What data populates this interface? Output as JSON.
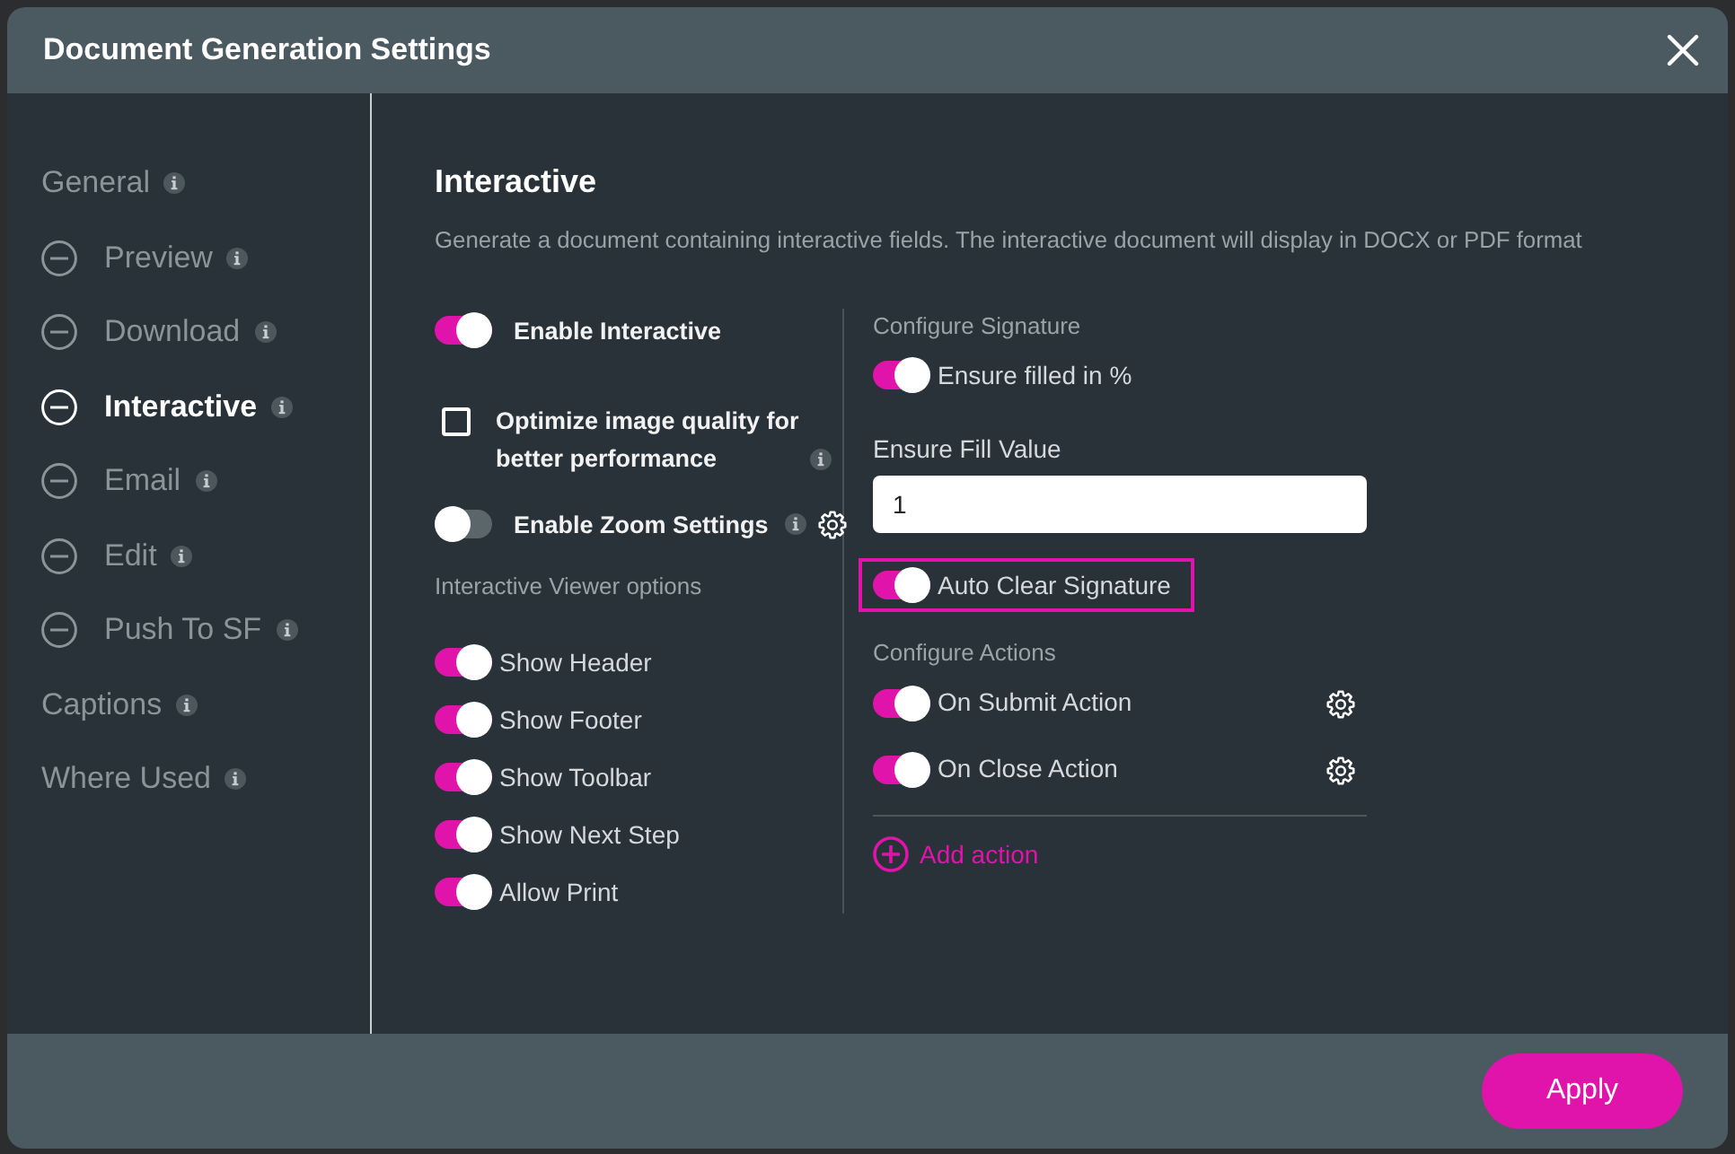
{
  "window": {
    "title": "Document Generation Settings"
  },
  "sidebar": {
    "items": [
      {
        "label": "General",
        "selected": false,
        "children": [
          {
            "label": "Preview",
            "selected": false
          },
          {
            "label": "Download",
            "selected": false
          },
          {
            "label": "Interactive",
            "selected": true
          },
          {
            "label": "Email",
            "selected": false
          },
          {
            "label": "Edit",
            "selected": false
          },
          {
            "label": "Push To SF",
            "selected": false
          }
        ]
      },
      {
        "label": "Captions",
        "selected": false
      },
      {
        "label": "Where Used",
        "selected": false
      }
    ]
  },
  "panel": {
    "title": "Interactive",
    "description": "Generate a document containing interactive fields. The interactive document will display in DOCX or PDF format",
    "enable_interactive": {
      "label": "Enable Interactive",
      "on": true
    },
    "optimize_image": {
      "label": "Optimize image quality for better performance",
      "checked": false
    },
    "enable_zoom": {
      "label": "Enable Zoom Settings",
      "on": false
    },
    "viewer_options": {
      "title": "Interactive Viewer options",
      "items": [
        {
          "label": "Show Header",
          "on": true
        },
        {
          "label": "Show Footer",
          "on": true
        },
        {
          "label": "Show Toolbar",
          "on": true
        },
        {
          "label": "Show Next Step",
          "on": true
        },
        {
          "label": "Allow Print",
          "on": true
        }
      ]
    },
    "signature": {
      "title": "Configure Signature",
      "ensure_filled": {
        "label": "Ensure filled in %",
        "on": true
      },
      "fill_value": {
        "label": "Ensure Fill Value",
        "value": "1"
      },
      "auto_clear": {
        "label": "Auto Clear Signature",
        "on": true,
        "highlighted": true
      }
    },
    "actions": {
      "title": "Configure Actions",
      "items": [
        {
          "label": "On Submit Action",
          "on": true
        },
        {
          "label": "On Close Action",
          "on": true
        }
      ],
      "add_label": "Add action"
    }
  },
  "footer": {
    "buttons": [
      "Apply"
    ]
  }
}
